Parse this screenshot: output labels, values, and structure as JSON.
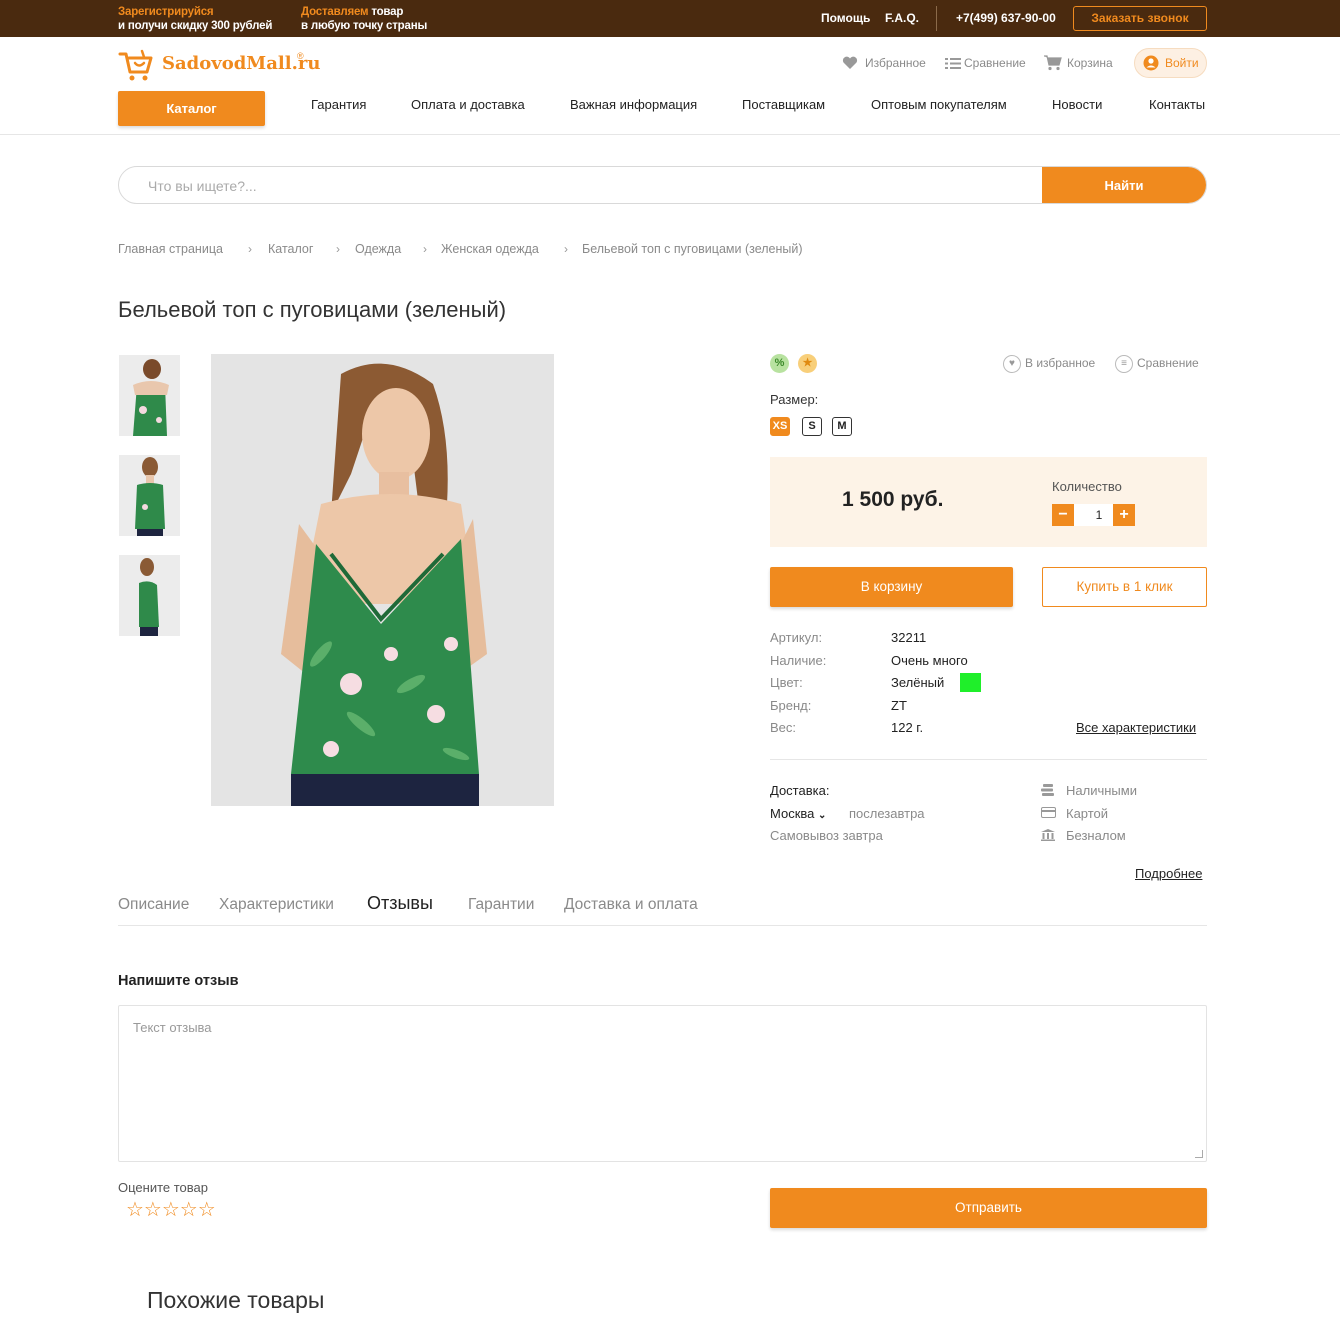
{
  "topbar": {
    "promo1_hl": "Зарегистрируйся",
    "promo1_rest": "и получи скидку 300 рублей",
    "promo2_hl": "Доставляем",
    "promo2_mid": " товар",
    "promo2_rest": "в любую точку страны",
    "help": "Помощь",
    "faq": "F.A.Q.",
    "phone": "+7(499) 637-90-00",
    "callback": "Заказать звонок"
  },
  "header": {
    "logo": "SadovodMall.ru",
    "logo_mark": "®",
    "favorites": "Избранное",
    "compare": "Сравнение",
    "cart": "Корзина",
    "login": "Войти"
  },
  "nav": {
    "catalog": "Каталог",
    "items": [
      "Гарантия",
      "Оплата и доставка",
      "Важная информация",
      "Поставщикам",
      "Оптовым покупателям",
      "Новости",
      "Контакты"
    ]
  },
  "search": {
    "placeholder": "Что вы ищете?...",
    "button": "Найти"
  },
  "breadcrumb": [
    "Главная страница",
    "Каталог",
    "Одежда",
    "Женская одежда",
    "Бельевой топ с пуговицами (зеленый)"
  ],
  "product": {
    "title": "Бельевой топ с пуговицами (зеленый)",
    "badge_discount": "%",
    "badge_star": "★",
    "to_favorites": "В избранное",
    "to_compare": "Сравнение",
    "size_label": "Размер:",
    "sizes": [
      "XS",
      "S",
      "M"
    ],
    "selected_size": "XS",
    "price": "1 500 руб.",
    "qty_label": "Количество",
    "qty": "1",
    "add_to_cart": "В корзину",
    "one_click": "Купить в 1 клик",
    "specs": [
      {
        "k": "Артикул:",
        "v": "32211"
      },
      {
        "k": "Наличие:",
        "v": "Очень много"
      },
      {
        "k": "Цвет:",
        "v": "Зелёный"
      },
      {
        "k": "Бренд:",
        "v": "ZT"
      },
      {
        "k": "Вес:",
        "v": "122 г."
      }
    ],
    "color_hex": "#1fef2a",
    "all_chars": "Все характеристики",
    "delivery_label": "Доставка:",
    "city": "Москва",
    "delivery_when": "послезавтра",
    "pickup": "Самовывоз завтра",
    "payments": [
      "Наличными",
      "Картой",
      "Безналом"
    ],
    "more": "Подробнее"
  },
  "tabs": [
    "Описание",
    "Характеристики",
    "Отзывы",
    "Гарантии",
    "Доставка и оплата"
  ],
  "active_tab": "Отзывы",
  "review": {
    "heading": "Напишите отзыв",
    "placeholder": "Текст отзыва",
    "rate_label": "Оцените товар",
    "stars": "☆☆☆☆☆",
    "submit": "Отправить"
  },
  "similar_title": "Похожие товары",
  "colors": {
    "accent": "#f08a1e",
    "topbar": "#4a2a0f",
    "price_bg": "#fdf3e7"
  }
}
